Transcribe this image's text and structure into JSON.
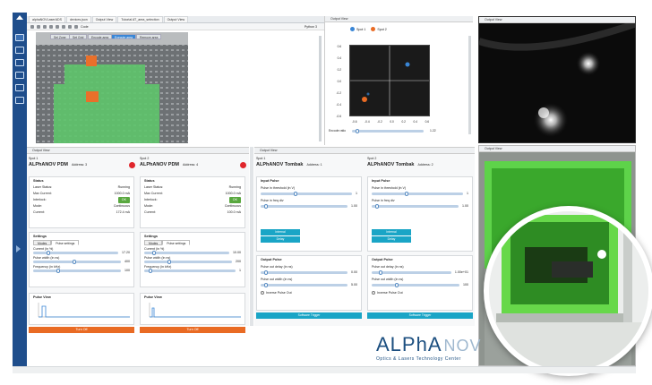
{
  "tabs": [
    {
      "label": "alphaNOVLaserADS"
    },
    {
      "label": "devices.json"
    },
    {
      "label": "Output View"
    },
    {
      "label": "Tutorial AT_area_selection"
    },
    {
      "label": "Output View"
    }
  ],
  "toolbar": {
    "mode": "Code",
    "kernel": "Python 3"
  },
  "notebook": {
    "segments": [
      "Sel Zone",
      "Set Grid",
      "Encode area",
      "Execute area",
      "Remove area"
    ],
    "active_segment": 3
  },
  "spot_view": {
    "title": "Output View",
    "legend": [
      "Spot 1",
      "Spot 2"
    ],
    "y_ticks": [
      "0.6",
      "0.4",
      "0.2",
      "0.0",
      "-0.2",
      "-0.4",
      "-0.6"
    ],
    "x_ticks": [
      "-0.6",
      "-0.4",
      "-0.2",
      "0.0",
      "0.2",
      "0.4",
      "0.6"
    ],
    "slider_label": "Encode ratio",
    "slider_value": "1.22",
    "colors": {
      "spot1": "#3a86d6",
      "spot2": "#e96b24"
    }
  },
  "camera": {
    "title": "Output View"
  },
  "bottom_left": {
    "title": "Output View",
    "devices": [
      {
        "spot": "Spot 1",
        "name": "ALPhANOV PDM",
        "address": "Address: 3",
        "status_title": "Status",
        "status": [
          {
            "k": "Laser Status:",
            "v": "Running"
          },
          {
            "k": "Max Current:",
            "v": "1000.0 mA"
          },
          {
            "k": "Interlock:",
            "v": "OK",
            "btn": true
          },
          {
            "k": "Mode:",
            "v": "Continuous"
          },
          {
            "k": "Current:",
            "v": "172.4 mA"
          }
        ],
        "settings_title": "Settings",
        "subtabs": [
          "Modes",
          "Pulse settings"
        ],
        "fields": [
          {
            "label": "Current (in %)",
            "value": "17.20",
            "pos": 0.17
          },
          {
            "label": "Pulse width (in ns)",
            "value": "400",
            "pos": 0.5
          },
          {
            "label": "Frequency (in kHz)",
            "value": "100",
            "pos": 0.3
          }
        ],
        "pulse_title": "Pulse View",
        "turn_btn": "Turn Off"
      },
      {
        "spot": "Spot 2",
        "name": "ALPhANOV PDM",
        "address": "Address: 4",
        "status_title": "Status",
        "status": [
          {
            "k": "Laser Status:",
            "v": "Running"
          },
          {
            "k": "Max Current:",
            "v": "1000.0 mA"
          },
          {
            "k": "Interlock:",
            "v": "OK",
            "btn": true
          },
          {
            "k": "Mode:",
            "v": "Continuous"
          },
          {
            "k": "Current:",
            "v": "100.0 mA"
          }
        ],
        "settings_title": "Settings",
        "subtabs": [
          "Modes",
          "Pulse settings"
        ],
        "fields": [
          {
            "label": "Current (in %)",
            "value": "10.00",
            "pos": 0.1
          },
          {
            "label": "Pulse width (in ns)",
            "value": "200",
            "pos": 0.3
          },
          {
            "label": "Frequency (in kHz)",
            "value": "1",
            "pos": 0.05
          }
        ],
        "pulse_title": "Pulse View",
        "turn_btn": "Turn Off"
      }
    ]
  },
  "mid": {
    "title": "Output View",
    "devices": [
      {
        "spot": "Spot 1",
        "name": "ALPhANOV Tombak",
        "address": "Address: 1",
        "input_title": "Input Pulse",
        "input_fields": [
          {
            "label": "Pulse in threshold (in V)",
            "value": "1",
            "pos": 0.4
          },
          {
            "label": "Pulse in freq div",
            "value": "1.00",
            "pos": 0.05
          }
        ],
        "btn_a": "Internal",
        "btn_b": "Delay",
        "output_title": "Output Pulse",
        "output_fields": [
          {
            "label": "Pulse out delay (in ns)",
            "value": "0.00",
            "pos": 0.05
          },
          {
            "label": "Pulse out width (in ns)",
            "value": "5.00",
            "pos": 0.05
          }
        ],
        "checkbox": "Inverse Pulse Out",
        "trigger": "Software Trigger"
      },
      {
        "spot": "Spot 2",
        "name": "ALPhANOV Tombak",
        "address": "Address: 2",
        "input_title": "Input Pulse",
        "input_fields": [
          {
            "label": "Pulse in threshold (in V)",
            "value": "1",
            "pos": 0.4
          },
          {
            "label": "Pulse in freq div",
            "value": "1.00",
            "pos": 0.05
          }
        ],
        "btn_a": "Internal",
        "btn_b": "Delay",
        "output_title": "Output Pulse",
        "output_fields": [
          {
            "label": "Pulse out delay (in ns)",
            "value": "1.00e+01",
            "pos": 0.1
          },
          {
            "label": "Pulse out width (in ns)",
            "value": "100",
            "pos": 0.3
          }
        ],
        "checkbox": "Inverse Pulse Out",
        "trigger": "Software Trigger"
      }
    ]
  },
  "photo": {
    "title": "Output View"
  },
  "logo": {
    "main": "ALPhA",
    "nov": "NOV",
    "sub": "Optics & Lasers Technology Center"
  }
}
